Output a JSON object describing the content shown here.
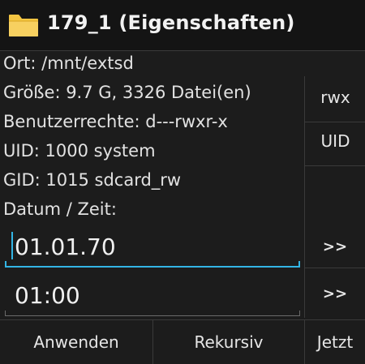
{
  "title": "179_1 (Eigenschaften)",
  "title_icon": "folder-icon",
  "info": {
    "location": "Ort: /mnt/extsd",
    "size": "Größe: 9.7 G, 3326 Datei(en)",
    "permissions": "Benutzerrechte: d---rwxr-x",
    "uid": "UID: 1000 system",
    "gid": "GID: 1015 sdcard_rw",
    "datetime_label": "Datum / Zeit:"
  },
  "side_buttons": {
    "rwx": "rwx",
    "uid": "UID"
  },
  "date_field": {
    "value": "01.01.70",
    "arrow": ">>"
  },
  "time_field": {
    "value": "01:00",
    "arrow": ">>"
  },
  "bottom_buttons": {
    "apply": "Anwenden",
    "recursive": "Rekursiv",
    "now": "Jetzt"
  },
  "colors": {
    "accent": "#33b5e5",
    "background": "#1c1c1c",
    "folder": "#f4c542"
  }
}
